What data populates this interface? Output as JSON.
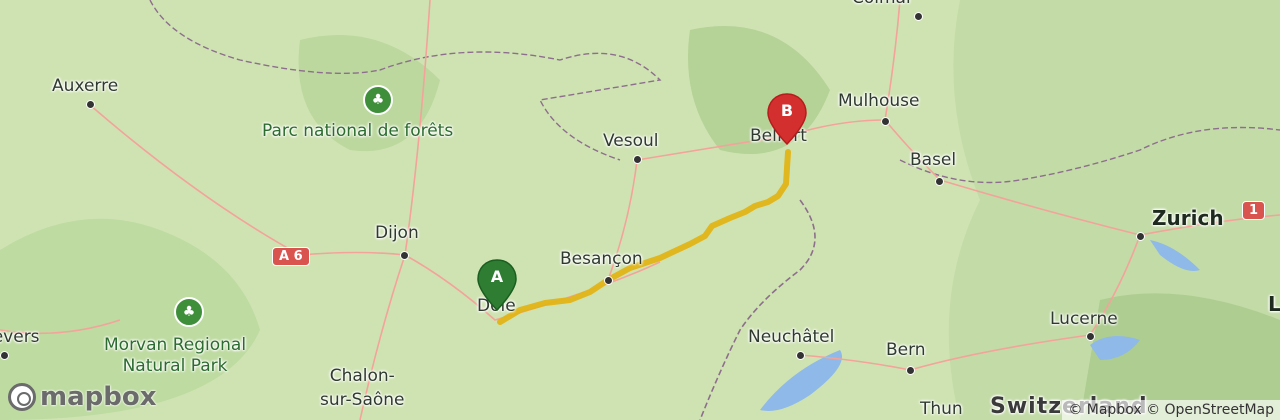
{
  "map": {
    "labels": {
      "auxerre": "Auxerre",
      "parc_forets": "Parc national de forêts",
      "vesoul": "Vesoul",
      "colmar": "Colmar",
      "belfort": "Belfort",
      "mulhouse": "Mulhouse",
      "basel": "Basel",
      "zurich": "Zurich",
      "dijon": "Dijon",
      "besancon": "Besançon",
      "dole": "Dole",
      "nevers": "Nevers",
      "morvan": "Morvan Regional\nNatural Park",
      "chalon": "Chalon-\nsur-Saône",
      "neuchatel": "Neuchâtel",
      "bern": "Bern",
      "lucerne": "Lucerne",
      "thun": "Thun",
      "switzerland": "Switzerland",
      "l_edge": "L"
    },
    "road_shields": {
      "a6": "A 6",
      "r1": "1"
    },
    "markers": {
      "start": "A",
      "end": "B"
    },
    "colors": {
      "route": "#e1b417",
      "start_marker": "#2e7d32",
      "end_marker": "#d32f2f",
      "water": "#8fb9e8",
      "road": "#f4a39a",
      "border": "#8d6e8d"
    }
  },
  "branding": {
    "logo_text": "mapbox"
  },
  "attribution": {
    "text": "© Mapbox © OpenStreetMap"
  }
}
